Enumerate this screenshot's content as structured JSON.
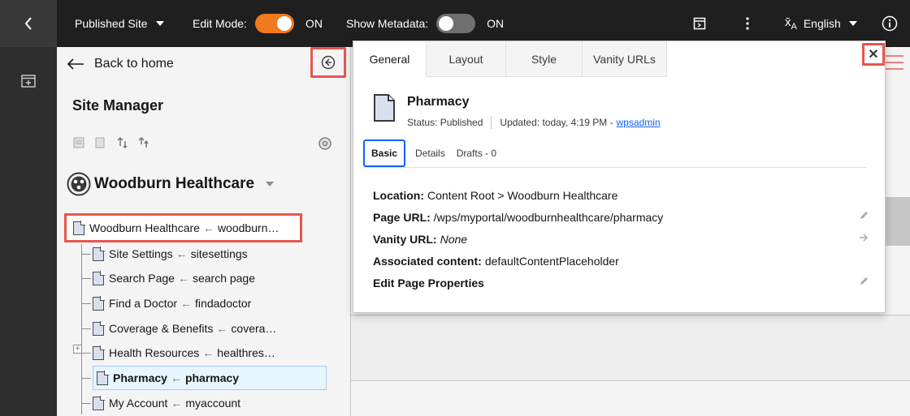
{
  "topbar": {
    "published_site": "Published Site",
    "edit_mode_label": "Edit Mode:",
    "edit_mode_state": "ON",
    "show_metadata_label": "Show Metadata:",
    "show_metadata_state": "ON",
    "language": "English",
    "accent_color": "#f1791f"
  },
  "site_manager": {
    "back_label": "Back to home",
    "title": "Site Manager",
    "site_name": "Woodburn Healthcare",
    "tree": {
      "root": {
        "title": "Woodburn Healthcare",
        "slug": "woodburn…"
      },
      "children": [
        {
          "title": "Site Settings",
          "slug": "sitesettings"
        },
        {
          "title": "Search Page",
          "slug": "search page"
        },
        {
          "title": "Find a Doctor",
          "slug": "findadoctor"
        },
        {
          "title": "Coverage & Benefits",
          "slug": "covera…"
        },
        {
          "title": "Health Resources",
          "slug": "healthres…"
        },
        {
          "title": "Pharmacy",
          "slug": "pharmacy"
        },
        {
          "title": "My Account",
          "slug": "myaccount"
        }
      ]
    }
  },
  "dialog": {
    "tabs": [
      "General",
      "Layout",
      "Style",
      "Vanity URLs"
    ],
    "page_name": "Pharmacy",
    "status": "Status: Published",
    "updated": "Updated: today, 4:19 PM -",
    "updated_by": "wpsadmin",
    "subtabs": [
      "Basic",
      "Details",
      "Drafts - 0"
    ],
    "props": {
      "location_label": "Location:",
      "location_value": "Content Root > Woodburn Healthcare",
      "page_url_label": "Page URL:",
      "page_url_value": "/wps/myportal/woodburnhealthcare/pharmacy",
      "vanity_url_label": "Vanity URL:",
      "vanity_url_value": "None",
      "associated_label": "Associated content:",
      "associated_value": "defaultContentPlaceholder",
      "edit_props_label": "Edit Page Properties"
    }
  },
  "colors": {
    "highlight_border": "#e8564e",
    "link": "#0f62fe",
    "selected_row": "#e5f6ff"
  },
  "icons": [
    "chevron-left-icon",
    "caret-down-icon",
    "panel-icon",
    "overflow-menu-icon",
    "translate-icon",
    "info-icon",
    "add-page-icon",
    "arrow-left-icon",
    "collapse-icon",
    "move-up-icon",
    "move-down-icon",
    "settings-icon",
    "site-logo-icon",
    "page-icon",
    "close-icon",
    "pencil-icon",
    "arrow-right-icon"
  ]
}
